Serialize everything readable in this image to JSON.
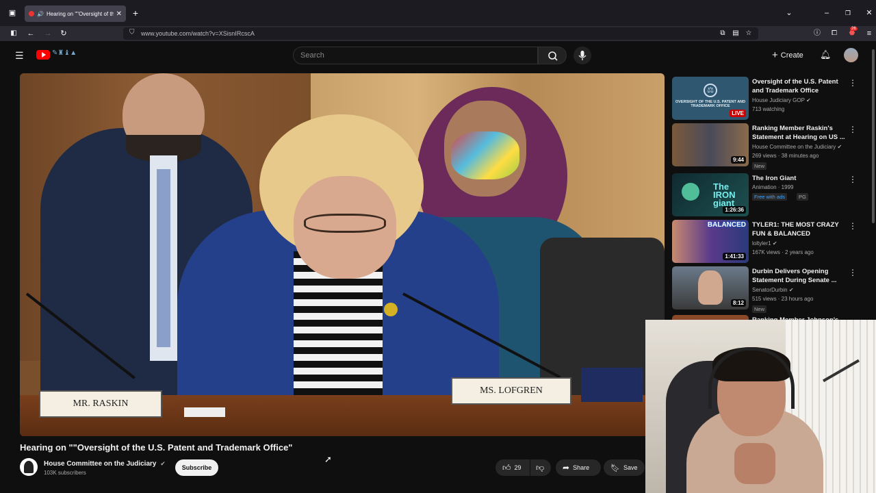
{
  "browser": {
    "tab_title": "Hearing on \"\"Oversight of the U.S",
    "url": "www.youtube.com/watch?v=XSisnIRcscA",
    "extension_badge": "26"
  },
  "header": {
    "search_placeholder": "Search",
    "create_label": "Create"
  },
  "video": {
    "title": "Hearing on \"\"Oversight of the U.S. Patent and Trademark Office\"",
    "nameplate_left": "MR. RASKIN",
    "nameplate_right": "MS. LOFGREN"
  },
  "channel": {
    "name": "House Committee on the Judiciary",
    "subscribers": "103K subscribers",
    "subscribe_label": "Subscribe"
  },
  "actions": {
    "likes": "29",
    "share_label": "Share",
    "save_label": "Save"
  },
  "recommendations": [
    {
      "title": "Oversight of the U.S. Patent and Trademark Office",
      "channel": "House Judiciary GOP",
      "meta": "713 watching",
      "overlay": "LIVE",
      "thumb_text": "OVERSIGHT OF THE U.S. PATENT AND TRADEMARK OFFICE"
    },
    {
      "title": "Ranking Member Raskin's Statement at Hearing on US ...",
      "channel": "House Committee on the Judiciary",
      "meta": "269 views · 38 minutes ago",
      "overlay": "9:44",
      "badge": "New"
    },
    {
      "title": "The Iron Giant",
      "channel": "Animation · 1999",
      "meta": "Free with ads",
      "rating": "PG",
      "overlay": "1:26:36",
      "thumb_text": "The IRON giant"
    },
    {
      "title": "TYLER1: THE MOST CRAZY FUN & BALANCED CHAMPION!!",
      "channel": "loltyler1",
      "meta": "167K views · 2 years ago",
      "overlay": "1:41:33",
      "thumb_text": "BALANCED"
    },
    {
      "title": "Durbin Delivers Opening Statement During Senate ...",
      "channel": "SenatorDurbin",
      "meta": "515 views · 23 hours ago",
      "overlay": "8:12",
      "badge": "New"
    },
    {
      "title": "Ranking Member Johnson's"
    }
  ],
  "colors": {
    "background": "#0f0f0f",
    "youtube_red": "#ff0000",
    "live_red": "#cc0000",
    "free_green": "#3ea6ff"
  }
}
